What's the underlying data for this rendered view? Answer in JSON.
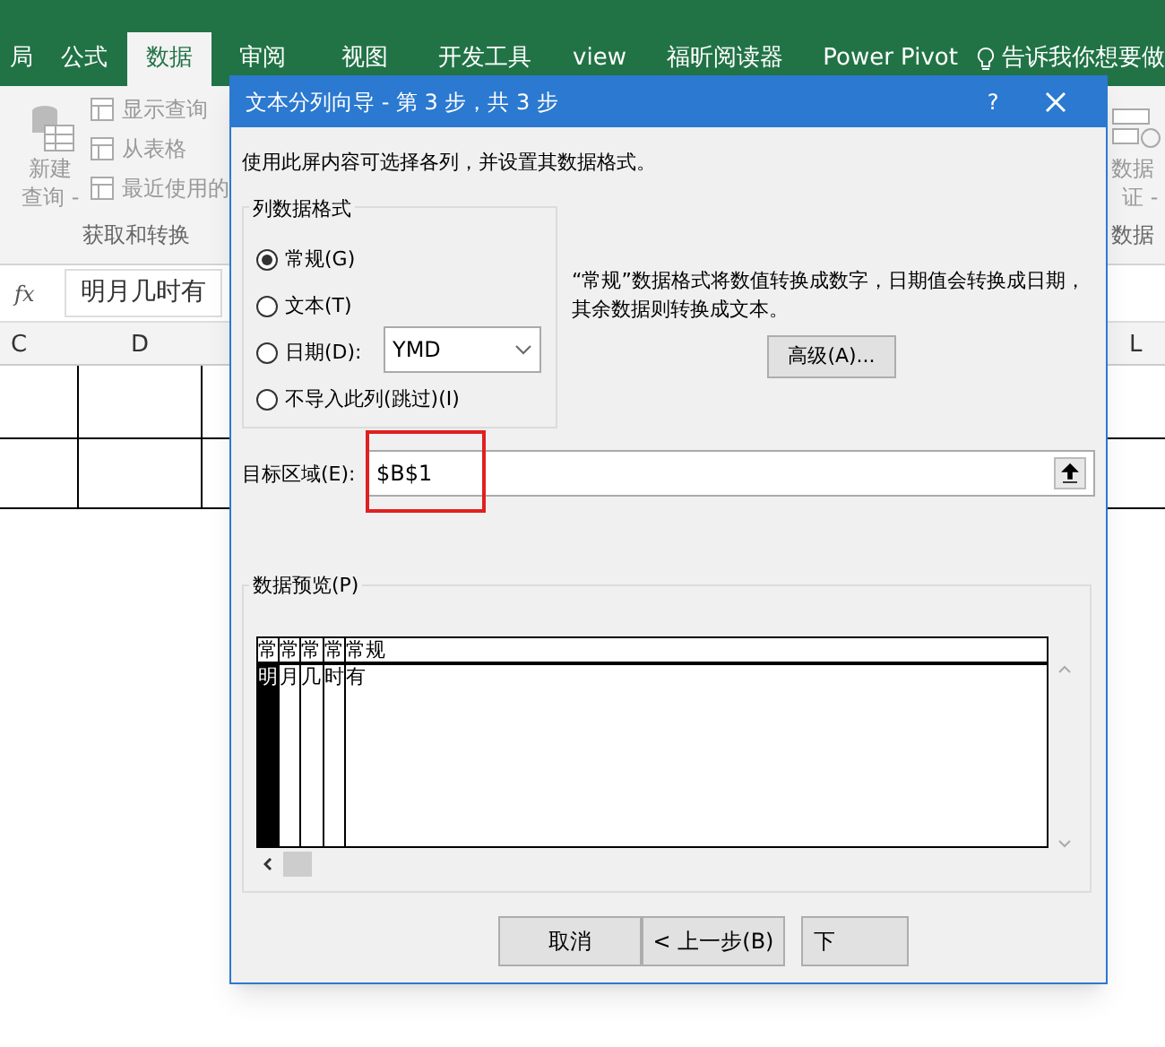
{
  "excel": {
    "tabs": [
      {
        "label": "局",
        "selected": false
      },
      {
        "label": "公式",
        "selected": false
      },
      {
        "label": "数据",
        "selected": true
      },
      {
        "label": "审阅",
        "selected": false
      },
      {
        "label": "视图",
        "selected": false
      },
      {
        "label": "开发工具",
        "selected": false
      },
      {
        "label": "view",
        "selected": false
      },
      {
        "label": "福昕阅读器",
        "selected": false
      },
      {
        "label": "Power Pivot",
        "selected": false
      }
    ],
    "tell_me": "告诉我你想要做",
    "ribbon": {
      "new_query": [
        "新建",
        "查询 -"
      ],
      "show_query": "显示查询",
      "from_table": "从表格",
      "recent": "最近使用的",
      "group": "获取和转换",
      "validation": [
        "数据",
        "证 -"
      ],
      "tools_group": "数据"
    },
    "formula_bar": {
      "fx": "fx",
      "value": "明月几时有"
    },
    "columns": [
      "C",
      "D",
      "L"
    ]
  },
  "dialog": {
    "title": "文本分列向导 - 第 3 步，共 3 步",
    "help": "?",
    "instruction": "使用此屏内容可选择各列，并设置其数据格式。",
    "format_group": "列数据格式",
    "formats": [
      {
        "label": "常规(G)",
        "selected": true
      },
      {
        "label": "文本(T)",
        "selected": false
      },
      {
        "label": "日期(D):",
        "selected": false
      },
      {
        "label": "不导入此列(跳过)(I)",
        "selected": false
      }
    ],
    "date_format": "YMD",
    "description": "“常规”数据格式将数值转换成数字，日期值会转换成日期，其余数据则转换成文本。",
    "advanced_button": "高级(A)...",
    "destination_label": "目标区域(E):",
    "destination_value": "$B$1",
    "destination_highlighted": true,
    "preview_label": "数据预览(P)",
    "preview_columns": [
      {
        "header": "常",
        "cells": [
          "明"
        ],
        "selected": true
      },
      {
        "header": "常",
        "cells": [
          "月"
        ],
        "selected": false
      },
      {
        "header": "常",
        "cells": [
          "几"
        ],
        "selected": false
      },
      {
        "header": "常",
        "cells": [
          "时"
        ],
        "selected": false
      },
      {
        "header": "常规",
        "cells": [
          "有"
        ],
        "selected": false
      }
    ],
    "buttons": [
      "取消",
      "< 上一步(B)",
      "下"
    ]
  }
}
